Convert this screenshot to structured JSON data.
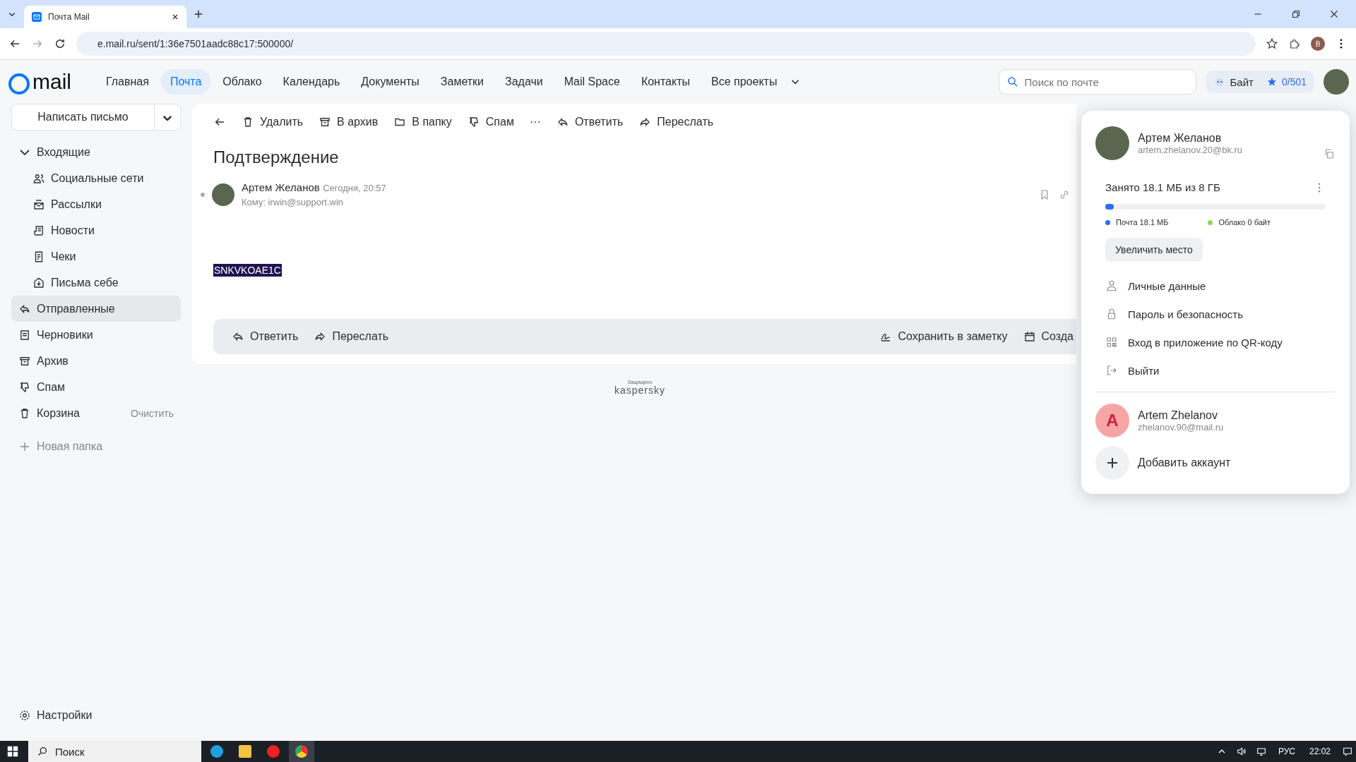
{
  "browser": {
    "tab_title": "Почта Mail",
    "url": "e.mail.ru/sent/1:36e7501aadc88c17:500000/",
    "profile_letter": "B"
  },
  "header": {
    "logo": "mail",
    "nav": [
      {
        "label": "Главная",
        "selected": false
      },
      {
        "label": "Почта",
        "selected": true
      },
      {
        "label": "Облако",
        "selected": false
      },
      {
        "label": "Календарь",
        "selected": false
      },
      {
        "label": "Документы",
        "selected": false
      },
      {
        "label": "Заметки",
        "selected": false
      },
      {
        "label": "Задачи",
        "selected": false
      },
      {
        "label": "Mail Space",
        "selected": false
      },
      {
        "label": "Контакты",
        "selected": false
      },
      {
        "label": "Все проекты",
        "selected": false
      }
    ],
    "search": {
      "placeholder": "Поиск по почте"
    },
    "bait": "Байт",
    "stars_count": "0/501"
  },
  "sidebar": {
    "compose": "Написать письмо",
    "folders": [
      {
        "label": "Входящие",
        "selected": false,
        "children": [
          {
            "label": "Социальные сети",
            "selected": false
          },
          {
            "label": "Рассылки",
            "selected": false
          },
          {
            "label": "Новости",
            "selected": false
          },
          {
            "label": "Чеки",
            "selected": false
          },
          {
            "label": "Письма себе",
            "selected": false
          }
        ]
      },
      {
        "label": "Отправленные",
        "selected": true
      },
      {
        "label": "Черновики",
        "selected": false
      },
      {
        "label": "Архив",
        "selected": false
      },
      {
        "label": "Спам",
        "selected": false
      },
      {
        "label": "Корзина",
        "selected": false,
        "action": "Очистить"
      }
    ],
    "new_folder": "Новая папка",
    "settings": "Настройки"
  },
  "toolbar": [
    "Удалить",
    "В архив",
    "В папку",
    "Спам",
    "···",
    "Ответить",
    "Переслать"
  ],
  "message": {
    "subject": "Подтверждение",
    "sender": "Артем Желанов",
    "time": "Сегодня, 20:57",
    "to": "Кому: irwin@support.win",
    "body": "SNKVKOAE1C",
    "actions": [
      "Ответить",
      "Переслать"
    ],
    "right_actions": [
      "Сохранить в заметку",
      "Созда"
    ]
  },
  "footer": {
    "caption": "Защищено",
    "brand": "kaspersky"
  },
  "account_menu": {
    "name": "Артем Желанов",
    "email": "artem.zhelanov.20@bk.ru",
    "storage": {
      "title": "Занято 18.1 МБ из 8 ГБ",
      "level": 0.04,
      "legend": [
        {
          "label": "Почта 18.1 МБ",
          "color": "#2c6cf6"
        },
        {
          "label": "Облако 0 байт",
          "color": "#8bd654"
        }
      ],
      "button": "Увеличить место"
    },
    "items": [
      "Личные данные",
      "Пароль и безопасность",
      "Вход в приложение по QR-коду",
      "Выйти"
    ],
    "other_account": {
      "initial": "A",
      "name": "Artem Zhelanov",
      "email": "zhelanov.90@mail.ru"
    },
    "add_account": "Добавить аккаунт"
  },
  "taskbar": {
    "search": "Поиск",
    "lang": "РУС",
    "time": "22:02"
  }
}
